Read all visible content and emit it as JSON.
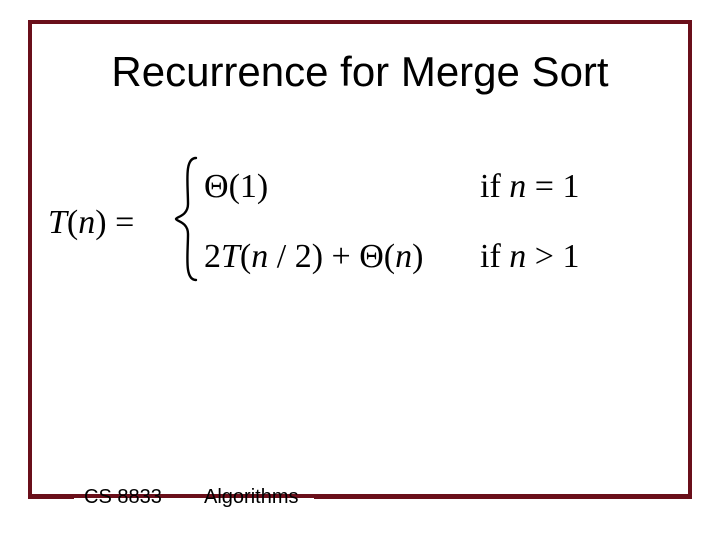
{
  "title": "Recurrence for Merge Sort",
  "equation": {
    "lhs": "T(n) =",
    "lhs_T": "T",
    "lhs_open": "(",
    "lhs_n": "n",
    "lhs_close": ")",
    "lhs_eq": " = ",
    "case1": {
      "expr_theta": "Θ",
      "expr_open": "(",
      "expr_val": "1",
      "expr_close": ")",
      "cond_if": "if ",
      "cond_n": "n",
      "cond_eq": " = ",
      "cond_val": "1"
    },
    "case2": {
      "expr_coef": "2",
      "expr_T": "T",
      "expr_open1": "(",
      "expr_n1": "n",
      "expr_div": " / 2",
      "expr_close1": ")",
      "expr_plus": " + ",
      "expr_theta": "Θ",
      "expr_open2": "(",
      "expr_n2": "n",
      "expr_close2": ")",
      "cond_if": "if ",
      "cond_n": "n",
      "cond_gt": " > ",
      "cond_val": "1"
    }
  },
  "footer": {
    "course": "CS 8833",
    "topic": "Algorithms"
  },
  "colors": {
    "border": "#6a0f1a"
  }
}
